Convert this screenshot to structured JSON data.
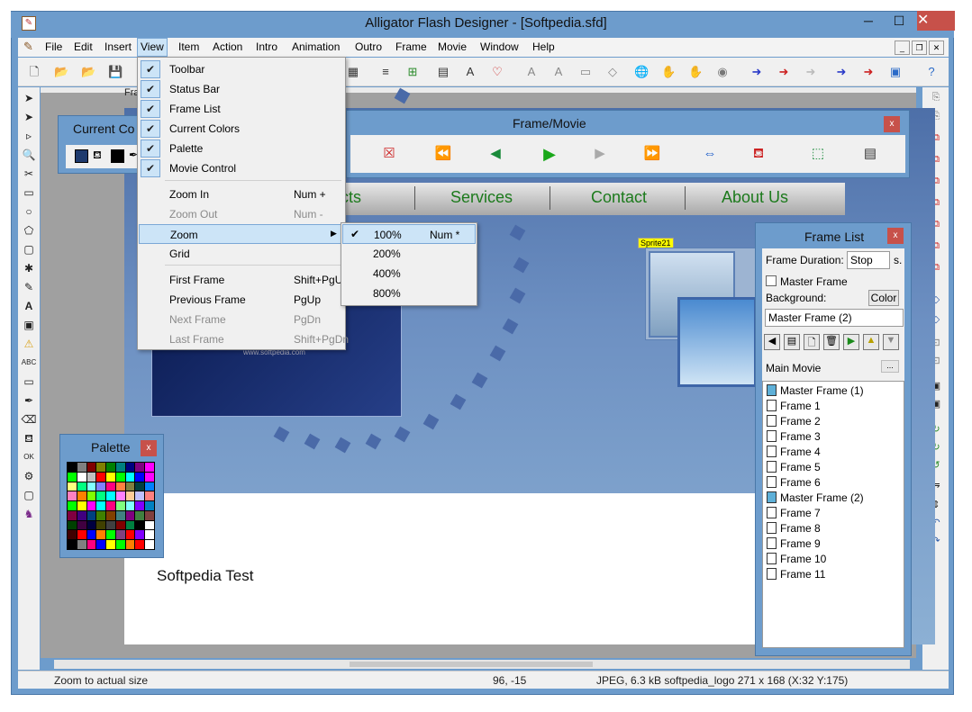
{
  "window": {
    "title": "Alligator Flash Designer - [Softpedia.sfd]",
    "minimize": "─",
    "maximize": "☐",
    "close": "✕"
  },
  "menubar": {
    "items": [
      "File",
      "Edit",
      "Insert",
      "View",
      "Item",
      "Action",
      "Intro",
      "Animation",
      "Outro",
      "Frame",
      "Movie",
      "Window",
      "Help"
    ],
    "active": "View"
  },
  "view_menu": {
    "items": [
      {
        "label": "Toolbar",
        "checked": true,
        "shortcut": "",
        "disabled": false
      },
      {
        "label": "Status Bar",
        "checked": true,
        "shortcut": "",
        "disabled": false
      },
      {
        "label": "Frame List",
        "checked": true,
        "shortcut": "",
        "disabled": false
      },
      {
        "label": "Current Colors",
        "checked": true,
        "shortcut": "",
        "disabled": false
      },
      {
        "label": "Palette",
        "checked": true,
        "shortcut": "",
        "disabled": false
      },
      {
        "label": "Movie Control",
        "checked": true,
        "shortcut": "",
        "disabled": false
      },
      {
        "label": "Zoom In",
        "checked": false,
        "shortcut": "Num +",
        "disabled": false
      },
      {
        "label": "Zoom Out",
        "checked": false,
        "shortcut": "Num -",
        "disabled": true
      },
      {
        "label": "Zoom",
        "checked": false,
        "shortcut": "",
        "disabled": false,
        "submenu": true
      },
      {
        "label": "Grid",
        "checked": false,
        "shortcut": "",
        "disabled": false
      },
      {
        "label": "First Frame",
        "checked": false,
        "shortcut": "Shift+PgUp",
        "disabled": false
      },
      {
        "label": "Previous Frame",
        "checked": false,
        "shortcut": "PgUp",
        "disabled": false
      },
      {
        "label": "Next Frame",
        "checked": false,
        "shortcut": "PgDn",
        "disabled": true
      },
      {
        "label": "Last Frame",
        "checked": false,
        "shortcut": "Shift+PgDn",
        "disabled": true
      }
    ]
  },
  "zoom_submenu": {
    "items": [
      {
        "label": "100%",
        "shortcut": "Num *",
        "checked": true
      },
      {
        "label": "200%",
        "shortcut": "",
        "checked": false
      },
      {
        "label": "400%",
        "shortcut": "",
        "checked": false
      },
      {
        "label": "800%",
        "shortcut": "",
        "checked": false
      }
    ]
  },
  "panels": {
    "current_colors": {
      "title": "Current Co"
    },
    "palette": {
      "title": "Palette",
      "close": "x"
    },
    "frame_movie": {
      "title": "Frame/Movie",
      "close": "x"
    },
    "frame_list": {
      "title": "Frame List",
      "close": "x",
      "frame_duration_label": "Frame Duration:",
      "frame_duration_value": "Stop",
      "frame_duration_unit": "s.",
      "master_frame_label": "Master Frame",
      "background_label": "Background:",
      "color_button": "Color",
      "master_select": "Master Frame (2)",
      "main_movie_label": "Main Movie",
      "main_movie_btn": "...",
      "frames": [
        {
          "label": "Master Frame (1)",
          "master": true
        },
        {
          "label": "Frame 1",
          "master": false
        },
        {
          "label": "Frame 2",
          "master": false
        },
        {
          "label": "Frame 3",
          "master": false
        },
        {
          "label": "Frame 4",
          "master": false
        },
        {
          "label": "Frame 5",
          "master": false
        },
        {
          "label": "Frame 6",
          "master": false
        },
        {
          "label": "Master Frame (2)",
          "master": true
        },
        {
          "label": "Frame 7",
          "master": false
        },
        {
          "label": "Frame 8",
          "master": false
        },
        {
          "label": "Frame 9",
          "master": false
        },
        {
          "label": "Frame 10",
          "master": false
        },
        {
          "label": "Frame 11",
          "master": false
        }
      ]
    }
  },
  "stage": {
    "nav_links": [
      "ucts",
      "Services",
      "Contact",
      "About Us"
    ],
    "text": "Softpedia Test",
    "photo_caption": "www.softpedia.com",
    "sprite_label": "Sprite21",
    "frame_label": "Fra"
  },
  "palette_colors": [
    "#000000",
    "#808080",
    "#800000",
    "#808000",
    "#008000",
    "#008080",
    "#000080",
    "#800080",
    "#ff00ff",
    "#00ff00",
    "#ffffff",
    "#c0c0c0",
    "#ff0000",
    "#ffff00",
    "#00ff00",
    "#00ffff",
    "#0000ff",
    "#ff00ff",
    "#ffff80",
    "#00ff80",
    "#80ffff",
    "#8080ff",
    "#ff0080",
    "#ff8040",
    "#808040",
    "#004040",
    "#0080ff",
    "#ff80c0",
    "#ff8000",
    "#80ff00",
    "#00ff80",
    "#00ffff",
    "#ff80ff",
    "#ffcc99",
    "#c0c0ff",
    "#ff8080",
    "#00ff00",
    "#ffff00",
    "#ff00ff",
    "#00ffff",
    "#ff0080",
    "#80ff80",
    "#80ffff",
    "#8000ff",
    "#0080c0",
    "#800040",
    "#400080",
    "#004080",
    "#408000",
    "#804000",
    "#408080",
    "#800080",
    "#408040",
    "#804040",
    "#004000",
    "#400040",
    "#000040",
    "#404000",
    "#404040",
    "#800000",
    "#008040",
    "#000000",
    "#ffffff",
    "#400000",
    "#ff0000",
    "#0000ff",
    "#ff8000",
    "#00ff00",
    "#804080",
    "#ff0000",
    "#8000ff",
    "#ffffff",
    "#000000",
    "#808080",
    "#ff0080",
    "#0000ff",
    "#ffff00",
    "#00ff00",
    "#ff8000",
    "#ff0000",
    "#ffffff"
  ],
  "statusbar": {
    "hint": "Zoom to actual size",
    "coords": "96, -15",
    "info": "JPEG, 6.3 kB softpedia_logo 271 x 168 (X:32 Y:175)"
  }
}
